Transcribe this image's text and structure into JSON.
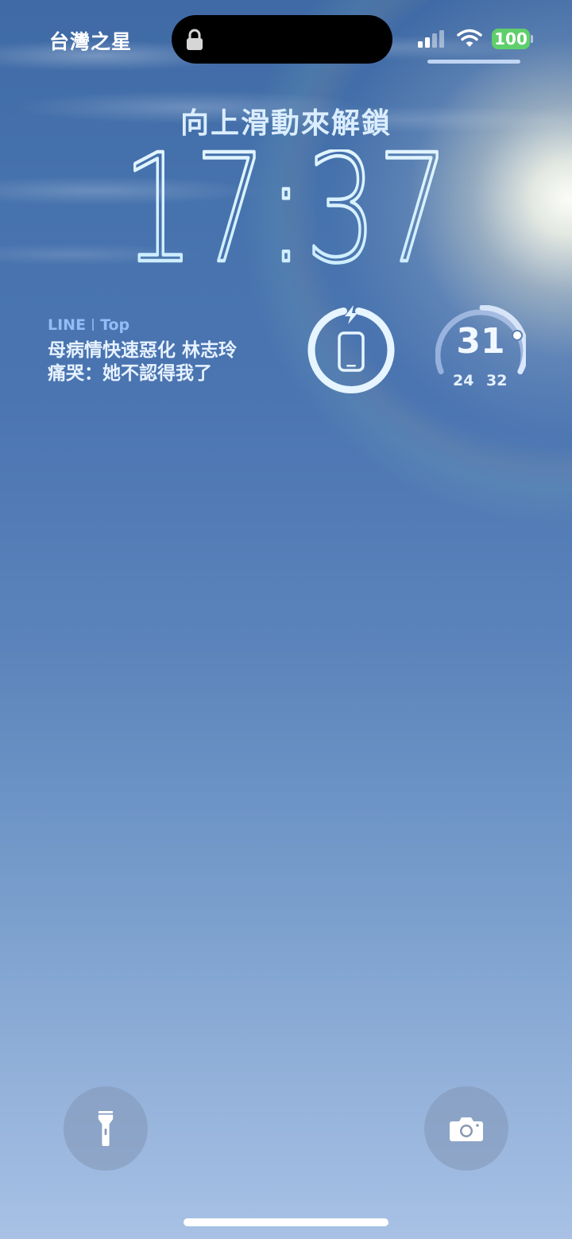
{
  "status_bar": {
    "carrier": "台灣之星",
    "battery_level": "100",
    "lock_icon": "lock-icon",
    "signal_icon": "cellular-signal-icon",
    "wifi_icon": "wifi-icon",
    "battery_color": "#5fcf6b"
  },
  "lock_screen": {
    "unlock_hint": "向上滑動來解鎖",
    "time": "17:37"
  },
  "widgets": {
    "news": {
      "source": "LINE",
      "section": "Top",
      "headline_line1": "母病情快速惡化 林志玲",
      "headline_line2": "痛哭：她不認得我了"
    },
    "charging": {
      "icon": "phone-charging-icon"
    },
    "weather": {
      "current_temp": "31",
      "low": "24",
      "high": "32"
    }
  },
  "bottom_actions": {
    "flashlight_icon": "flashlight-icon",
    "camera_icon": "camera-icon"
  },
  "colors": {
    "accent": "#93bdf5",
    "clock": "#d9f0ff"
  }
}
